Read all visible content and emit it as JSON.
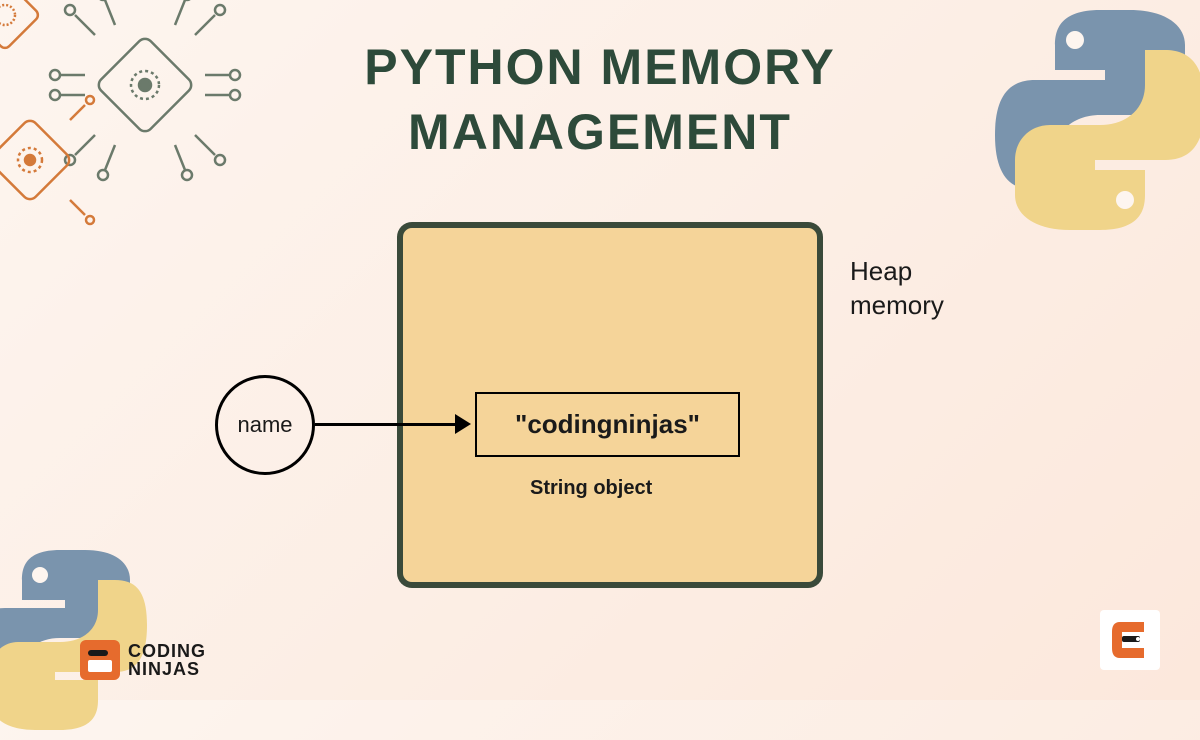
{
  "title_line1": "PYTHON MEMORY",
  "title_line2": "MANAGEMENT",
  "heap_label_line1": "Heap",
  "heap_label_line2": "memory",
  "variable_name": "name",
  "string_value": "\"codingninjas\"",
  "object_label": "String object",
  "brand": {
    "name_line1": "CODING",
    "name_line2": "NINJAS"
  }
}
